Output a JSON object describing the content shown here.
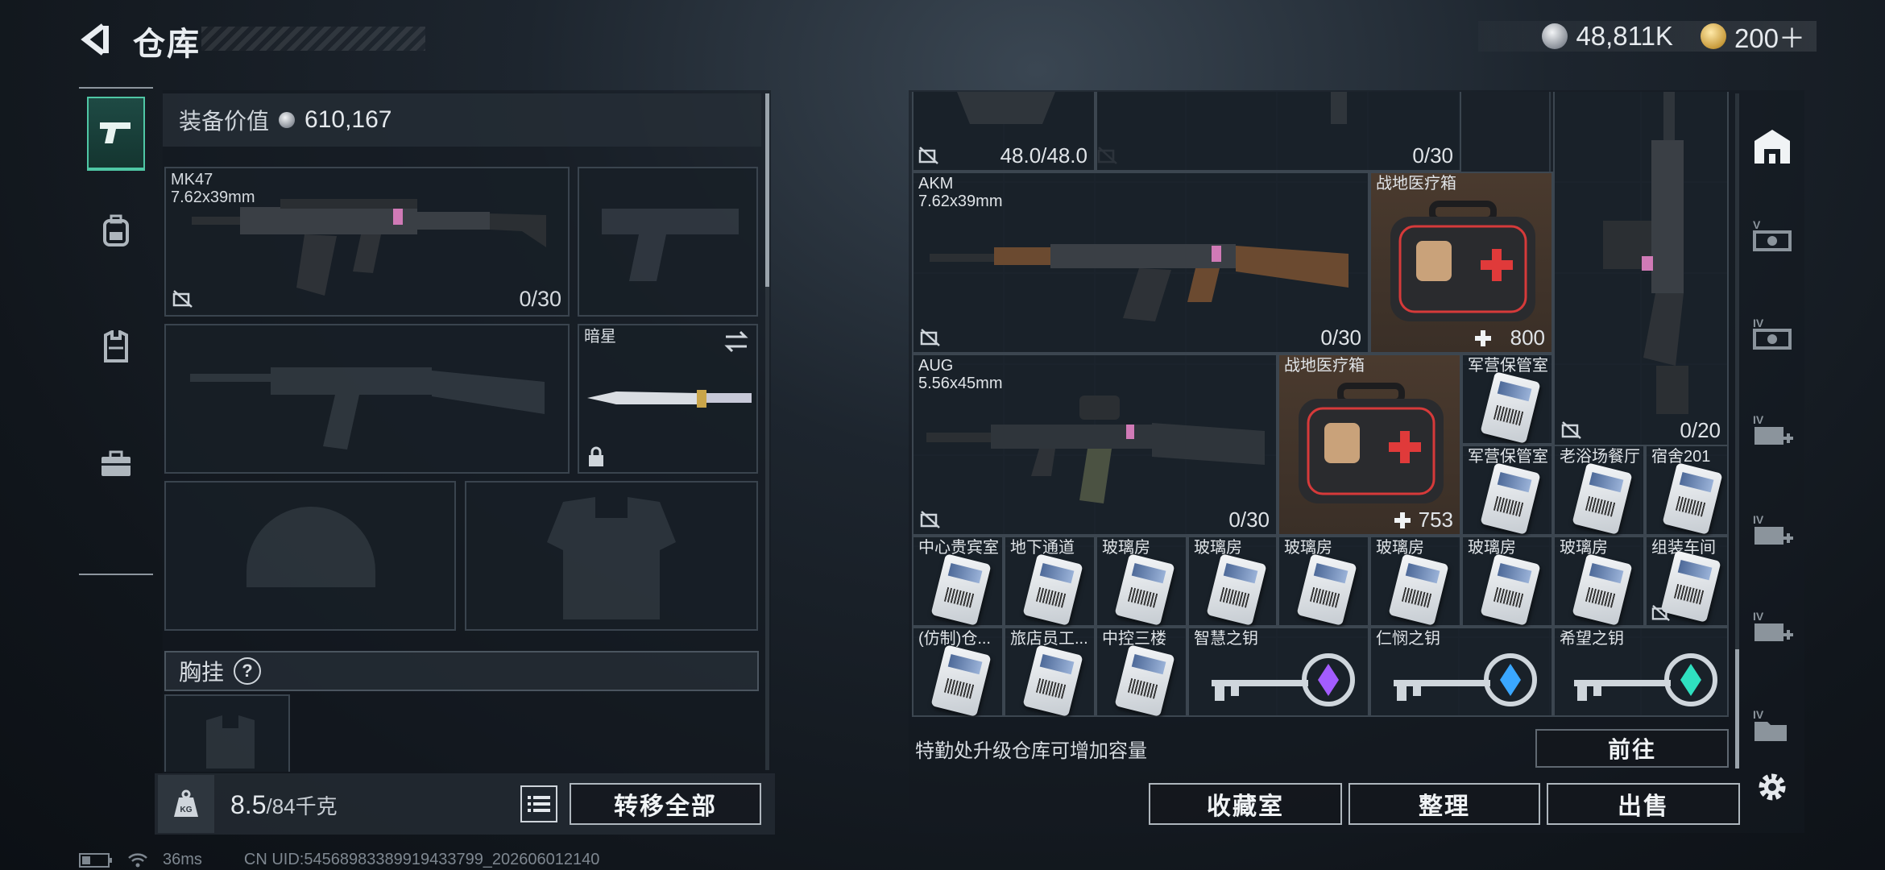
{
  "header": {
    "title": "仓库",
    "currency_silver": "48,811K",
    "currency_gold": "200＋"
  },
  "sidebar_left": {
    "items": [
      "pistol-tab",
      "backpack-tab",
      "vest-tab",
      "briefcase-tab"
    ]
  },
  "equipment": {
    "value_label": "装备价值",
    "value": "610,167",
    "primary": {
      "name": "MK47",
      "caliber": "7.62x39mm",
      "ammo": "0/30"
    },
    "melee": {
      "name": "暗星"
    },
    "chest_rig_label": "胸挂",
    "chest_rig_help": "?"
  },
  "bottom_left": {
    "weight": "8.5",
    "capacity": "/84千克",
    "transfer_all": "转移全部"
  },
  "storage": {
    "row0": {
      "helmet_durability": "48.0/48.0",
      "gun_ammo": "0/30"
    },
    "akm": {
      "name": "AKM",
      "caliber": "7.62x39mm",
      "ammo": "0/30"
    },
    "medkit1": {
      "name": "战地医疗箱",
      "amount": "800"
    },
    "aug": {
      "name": "AUG",
      "caliber": "5.56x45mm",
      "ammo": "0/30"
    },
    "medkit2": {
      "name": "战地医疗箱",
      "amount": "753"
    },
    "vertical_gun": {
      "ammo": "0/20"
    },
    "cards": [
      {
        "label": "军营保管室"
      },
      {
        "label": "军营保管室"
      },
      {
        "label": "老浴场餐厅"
      },
      {
        "label": "宿舍201"
      },
      {
        "label": "中心贵宾室"
      },
      {
        "label": "地下通道"
      },
      {
        "label": "玻璃房"
      },
      {
        "label": "玻璃房"
      },
      {
        "label": "玻璃房"
      },
      {
        "label": "玻璃房"
      },
      {
        "label": "玻璃房"
      },
      {
        "label": "玻璃房"
      },
      {
        "label": "组装车间"
      },
      {
        "label": "(仿制)仓..."
      },
      {
        "label": "旅店员工..."
      },
      {
        "label": "中控三楼"
      }
    ],
    "keys": [
      {
        "label": "智慧之钥",
        "gem": "#a35cff"
      },
      {
        "label": "仁悯之钥",
        "gem": "#3aa7ff"
      },
      {
        "label": "希望之钥",
        "gem": "#2fe0c0"
      }
    ],
    "upgrade_hint": "特勤处升级仓库可增加容量",
    "goto": "前往"
  },
  "actions": {
    "collection": "收藏室",
    "organize": "整理",
    "sell": "出售"
  },
  "sidebar_right": {
    "items": [
      "safehouse",
      "v-case",
      "iv-case",
      "iv-slot-1",
      "iv-slot-2",
      "iv-slot-3",
      "iv-folder",
      "settings"
    ]
  },
  "status_bar": {
    "ping": "36ms",
    "uid": "CN UID:54568983389919433799_202606012140"
  }
}
